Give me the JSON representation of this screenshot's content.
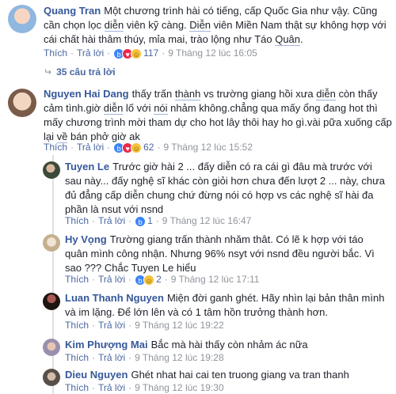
{
  "comments": [
    {
      "author": "Quang Tran",
      "parts": [
        {
          "t": "Một chương trình hài có tiếng, cấp Quốc Gia như vậy. Cũng cần chọn lọc "
        },
        {
          "t": "diễn",
          "hl": true
        },
        {
          "t": " viên kỹ càng. "
        },
        {
          "t": "Diễn",
          "hl": true
        },
        {
          "t": " viên Miền Nam thật sự không hợp với cái chất hài thâm thúy, mỉa mai, trào lộng như Táo "
        },
        {
          "t": "Quân",
          "hl": true
        },
        {
          "t": "."
        }
      ],
      "like": "Thích",
      "reply": "Trả lời",
      "reactions": [
        "like",
        "love",
        "haha"
      ],
      "count": "117",
      "time": "9 Tháng 12 lúc 16:05",
      "replies_label": "35 câu trả lời"
    },
    {
      "author": "Nguyen Hai Dang",
      "parts": [
        {
          "t": "thấy trấn "
        },
        {
          "t": "thành",
          "hl": true
        },
        {
          "t": " vs trường giang hồi xưa "
        },
        {
          "t": "diễn",
          "hl": true
        },
        {
          "t": " còn thấy cảm tình.giờ "
        },
        {
          "t": "diễn",
          "hl": true
        },
        {
          "t": " lố với "
        },
        {
          "t": "nói",
          "hl": true
        },
        {
          "t": " nhảm không.chẳng qua mấy ổng đang hot thì mấy chương trình mời tham dự cho hot lây thôi hay ho gì.vài pữa xuống cấp lại "
        },
        {
          "t": "về",
          "hl": true
        },
        {
          "t": " bán phở giờ ak"
        }
      ],
      "like": "Thích",
      "reply": "Trả lời",
      "reactions": [
        "like",
        "love",
        "haha"
      ],
      "count": "62",
      "time": "9 Tháng 12 lúc 15:52"
    },
    {
      "author": "Tuyen Le",
      "parts": [
        {
          "t": "Trước giờ hài 2 ... đấy diễn có ra cái gì đâu mà trước với sau này... đấy nghệ sĩ khác còn giỏi hơn chưa đến lượt 2 ... này, chưa đủ đẳng cấp diễn chung chứ đừng nói có hợp vs các nghệ sĩ hài đa phần là nsut với nsnd"
        }
      ],
      "like": "Thích",
      "reply": "Trả lời",
      "reactions": [
        "like"
      ],
      "count": "1",
      "time": "9 Tháng 12 lúc 16:47"
    },
    {
      "author": "Hy Vọng",
      "parts": [
        {
          "t": "Trường giang trấn thành nhăm thât. Có lẽ k hợp với táo quân mình công nhận. Nhưng 96% nsyt với nsnd đều người bắc. Vì sao ??? Chắc Tuyen Le hiểu"
        }
      ],
      "like": "Thích",
      "reply": "Trả lời",
      "reactions": [
        "like",
        "haha"
      ],
      "count": "2",
      "time": "9 Tháng 12 lúc 17:11"
    },
    {
      "author": "Luan Thanh Nguyen",
      "parts": [
        {
          "t": "Miện đời ganh ghét. Hãy nhìn lại bản thân mình và im lặng. Để lớn lên và có 1 tâm hồn trưởng thành hơn."
        }
      ],
      "like": "Thích",
      "reply": "Trả lời",
      "reactions": [],
      "count": "",
      "time": "9 Tháng 12 lúc 19:22"
    },
    {
      "author": "Kim Phượng Mai",
      "parts": [
        {
          "t": "Bắc mà hài thấy còn nhảm ác nữa"
        }
      ],
      "like": "Thích",
      "reply": "Trả lời",
      "reactions": [],
      "count": "",
      "time": "9 Tháng 12 lúc 19:28"
    },
    {
      "author": "Dieu Nguyen",
      "parts": [
        {
          "t": "Ghét nhat hai cai ten truong giang va tran thanh"
        }
      ],
      "like": "Thích",
      "reply": "Trả lời",
      "reactions": [],
      "count": "",
      "time": "9 Tháng 12 lúc 19:30"
    }
  ]
}
